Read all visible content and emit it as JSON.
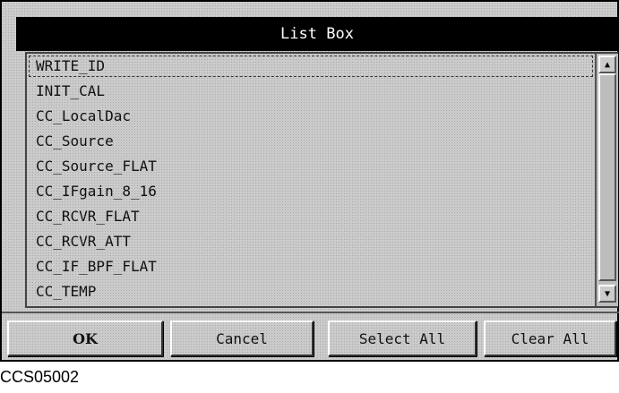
{
  "dialog": {
    "title": "List Box",
    "items": [
      "WRITE_ID",
      "INIT_CAL",
      "CC_LocalDac",
      "CC_Source",
      "CC_Source_FLAT",
      "CC_IFgain_8_16",
      "CC_RCVR_FLAT",
      "CC_RCVR_ATT",
      "CC_IF_BPF_FLAT",
      "CC_TEMP"
    ],
    "buttons": {
      "ok": "OK",
      "cancel": "Cancel",
      "select_all": "Select All",
      "clear_all": "Clear All"
    }
  },
  "caption": "CCS05002"
}
